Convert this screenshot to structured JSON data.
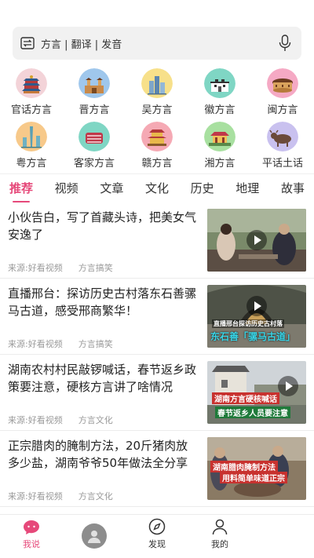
{
  "search": {
    "placeholder": "方言 | 翻译 | 发音"
  },
  "dialects": [
    {
      "label": "官话方言",
      "icon": "temple-of-heaven-icon"
    },
    {
      "label": "晋方言",
      "icon": "ancient-gate-icon"
    },
    {
      "label": "吴方言",
      "icon": "skyline-icon"
    },
    {
      "label": "徽方言",
      "icon": "hui-architecture-icon"
    },
    {
      "label": "闽方言",
      "icon": "tulou-icon"
    },
    {
      "label": "粤方言",
      "icon": "canton-tower-icon"
    },
    {
      "label": "客家方言",
      "icon": "red-meat-icon"
    },
    {
      "label": "赣方言",
      "icon": "tengwang-pavilion-icon"
    },
    {
      "label": "湘方言",
      "icon": "yuelu-pavilion-icon"
    },
    {
      "label": "平话土话",
      "icon": "ox-icon"
    }
  ],
  "tabs": [
    "推荐",
    "视频",
    "文章",
    "文化",
    "历史",
    "地理",
    "故事"
  ],
  "feed": [
    {
      "title": "小伙告白，写了首藏头诗，把美女气安逸了",
      "source": "来源:好看视频",
      "category": "方言搞笑"
    },
    {
      "title": "直播邢台：探访历史古村落东石善骡马古道，感受邢商繁华！",
      "source": "来源:好看视频",
      "category": "方言搞笑",
      "caption_small": "直播邢台探访历史古村落",
      "caption_big": "东石善「骡马古道」"
    },
    {
      "title": "湖南农村村民敲锣喊话，春节返乡政策要注意，硬核方言讲了啥情况",
      "source": "来源:好看视频",
      "category": "方言文化",
      "caption_top": "湖南方言硬核喊话",
      "caption_bottom": "春节返乡人员要注意"
    },
    {
      "title": "正宗腊肉的腌制方法，20斤猪肉放多少盐，湖南爷爷50年做法全分享",
      "source": "来源:好看视频",
      "category": "方言文化",
      "caption_top": "湖南腊肉腌制方法",
      "caption_bottom": "用料简单味道正宗"
    }
  ],
  "nav": {
    "speak": "我说",
    "discover": "发现",
    "mine": "我的"
  },
  "colors": {
    "accent": "#e6497a"
  }
}
